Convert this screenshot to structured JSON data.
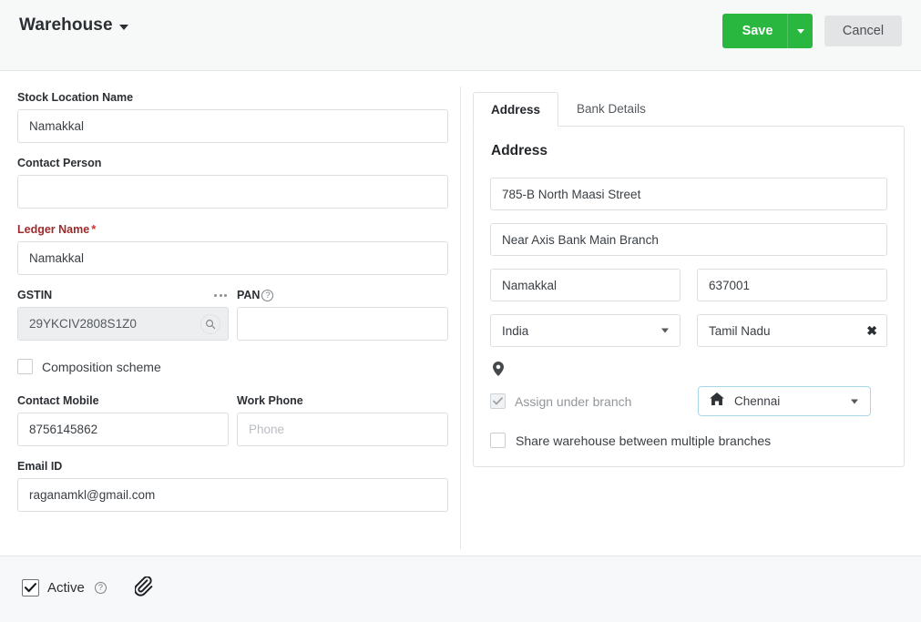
{
  "header": {
    "title": "Warehouse",
    "title_caret_icon": "chevron-down-icon",
    "save_label": "Save",
    "save_caret_icon": "chevron-down-icon",
    "cancel_label": "Cancel",
    "accent_green": "#29b740",
    "cancel_bg": "#e3e4e6"
  },
  "left_form": {
    "stock_location": {
      "label": "Stock Location Name",
      "value": "Namakkal"
    },
    "contact_person": {
      "label": "Contact Person",
      "value": ""
    },
    "ledger_name": {
      "label": "Ledger Name",
      "required_mark": "*",
      "value": "Namakkal",
      "label_color": "#9e2a2b"
    },
    "gstin": {
      "label": "GSTIN",
      "value": "29YKCIV2808S1Z0",
      "menu_icon": "ellipsis-icon",
      "search_icon": "search-icon"
    },
    "pan": {
      "label": "PAN",
      "value": "",
      "help_icon": "help-circle-icon",
      "help_glyph": "?"
    },
    "composition_scheme": {
      "label": "Composition scheme",
      "checked": false
    },
    "contact_mobile": {
      "label": "Contact Mobile",
      "value": "8756145862"
    },
    "work_phone": {
      "label": "Work Phone",
      "value": "",
      "placeholder": "Phone"
    },
    "email": {
      "label": "Email ID",
      "value": "raganamkl@gmail.com"
    }
  },
  "right_panel": {
    "tabs": [
      {
        "label": "Address",
        "active": true
      },
      {
        "label": "Bank Details",
        "active": false
      }
    ],
    "section_title": "Address",
    "line1": "785-B North Maasi Street",
    "line2": "Near Axis Bank Main Branch",
    "city": "Namakkal",
    "pincode": "637001",
    "country": {
      "value": "India",
      "caret_icon": "chevron-down-icon"
    },
    "state": {
      "value": "Tamil Nadu",
      "clear_icon": "close-icon",
      "clear_glyph": "✖"
    },
    "pin_icon": "map-pin-icon",
    "assign_branch": {
      "label": "Assign under branch",
      "checked": true,
      "disabled": true
    },
    "branch_select": {
      "value": "Chennai",
      "home_icon": "home-icon",
      "caret_icon": "chevron-down-icon",
      "border_color": "#a8d7e8"
    },
    "share_warehouse": {
      "label": "Share warehouse between multiple branches",
      "checked": false
    }
  },
  "footer": {
    "active": {
      "label": "Active",
      "checked": true,
      "help_icon": "help-circle-icon",
      "help_glyph": "?"
    },
    "attachment_icon": "paperclip-icon"
  }
}
